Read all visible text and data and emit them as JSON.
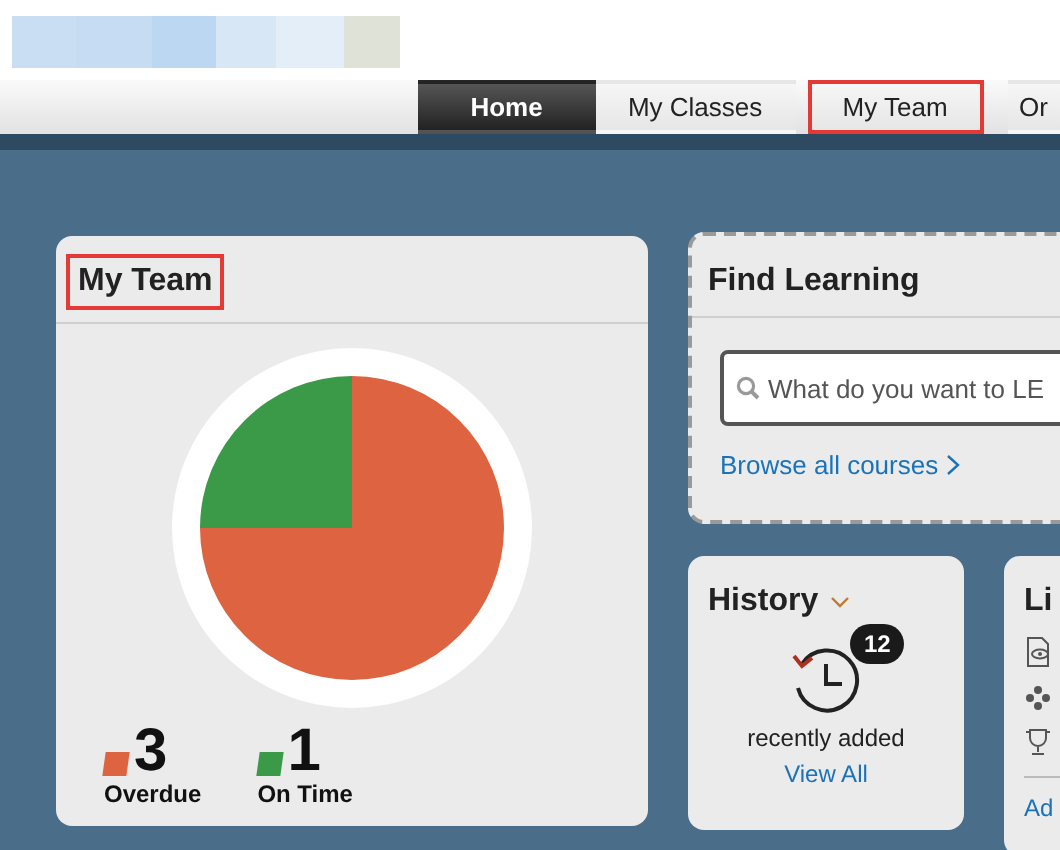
{
  "tabs": [
    {
      "label": "Home",
      "selected": true,
      "highlighted": false
    },
    {
      "label": "My Classes",
      "selected": false,
      "highlighted": false
    },
    {
      "label": "My Team",
      "selected": false,
      "highlighted": true
    },
    {
      "label": "Or",
      "selected": false,
      "highlighted": false
    }
  ],
  "team_card": {
    "title": "My Team",
    "highlighted": true,
    "chart_data": {
      "type": "pie",
      "categories": [
        "Overdue",
        "On Time"
      ],
      "values": [
        75,
        25
      ]
    },
    "legend": [
      {
        "count": "3",
        "color": "#de6341"
      },
      {
        "count": "1",
        "color": "#3a9a48"
      }
    ]
  },
  "find_learning": {
    "title": "Find Learning",
    "search": {
      "placeholder": "What do you want to LE"
    },
    "link": "Browse all courses"
  },
  "history": {
    "title": "History",
    "badge": "12",
    "caption": "recently added",
    "link": "View All"
  },
  "links_card": {
    "title": "Li",
    "link": "Ad"
  }
}
